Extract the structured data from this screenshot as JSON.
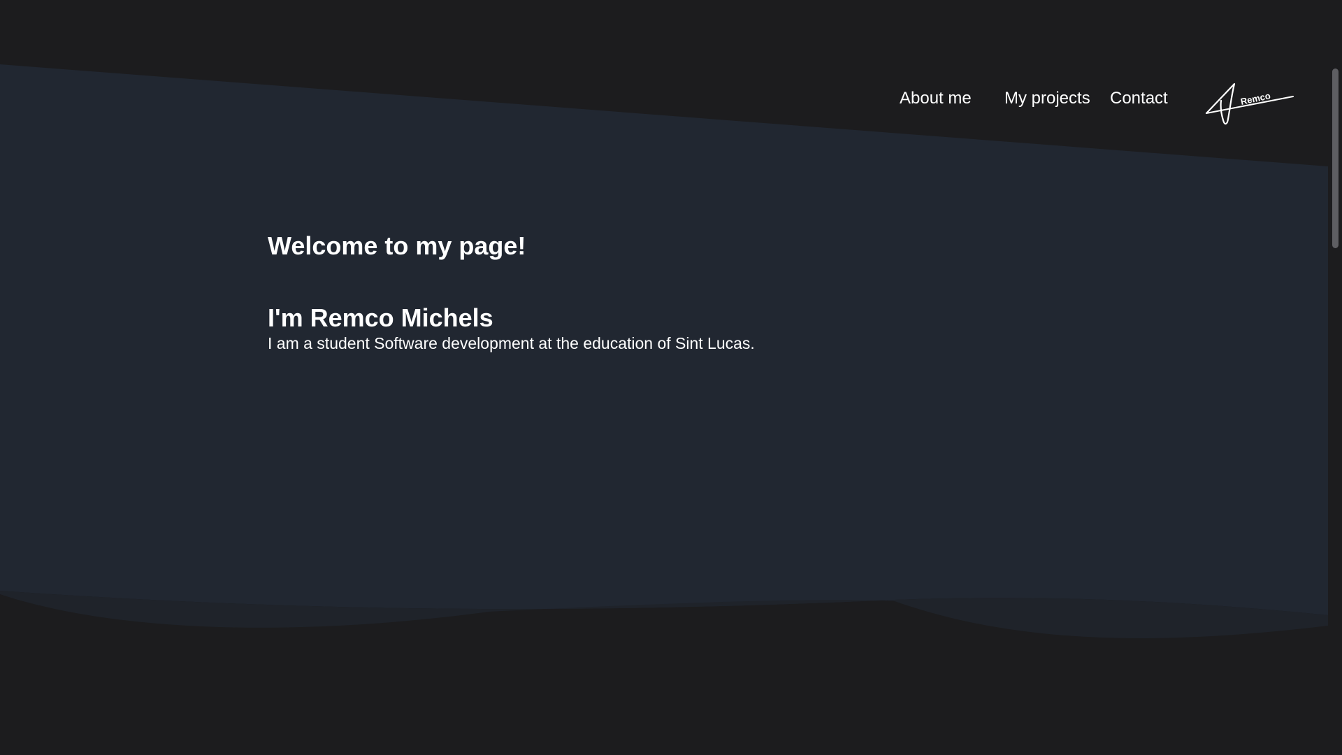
{
  "nav": {
    "about_label": "About me",
    "projects_label": "My projects",
    "contact_label": "Contact"
  },
  "logo": {
    "text": "Remco"
  },
  "hero": {
    "welcome": "Welcome to my page!",
    "name": "I'm Remco Michels",
    "bio": "I am a student Software development at the education of Sint Lucas."
  },
  "colors": {
    "page_background": "#1c1c1e",
    "panel_background": "#212731",
    "text": "#ffffff"
  }
}
